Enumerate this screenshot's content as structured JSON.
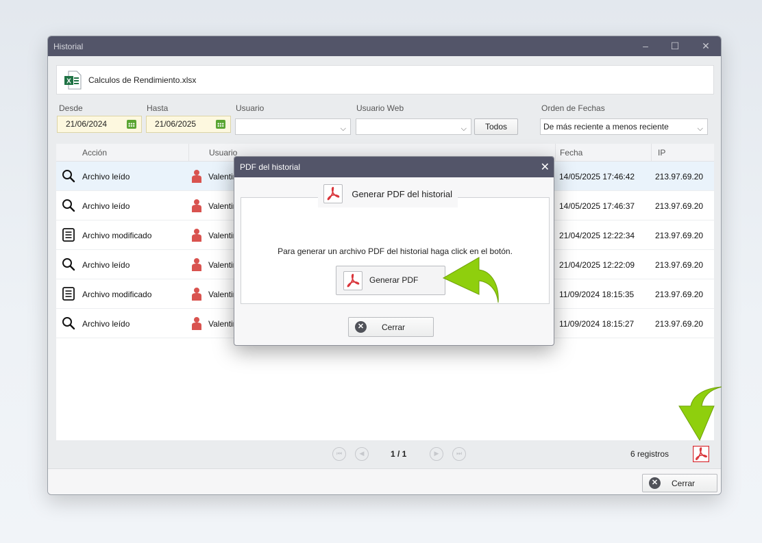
{
  "window": {
    "title": "Historial"
  },
  "file": {
    "name": "Calculos de Rendimiento.xlsx",
    "icon": "excel-icon"
  },
  "filters": {
    "desde_label": "Desde",
    "desde_value": "21/06/2024",
    "hasta_label": "Hasta",
    "hasta_value": "21/06/2025",
    "usuario_label": "Usuario",
    "usuario_value": "",
    "usuario_web_label": "Usuario Web",
    "usuario_web_value": "",
    "todos_label": "Todos",
    "orden_label": "Orden de Fechas",
    "orden_value": "De más reciente a menos reciente"
  },
  "grid": {
    "columns": [
      "Acción",
      "Usuario",
      "Fecha",
      "IP"
    ],
    "rows": [
      {
        "icon": "search-icon",
        "accion": "Archivo leído",
        "usuario": "Valentin",
        "fecha": "14/05/2025 17:46:42",
        "ip": "213.97.69.20"
      },
      {
        "icon": "search-icon",
        "accion": "Archivo leído",
        "usuario": "Valentin",
        "fecha": "14/05/2025 17:46:37",
        "ip": "213.97.69.20"
      },
      {
        "icon": "document-icon",
        "accion": "Archivo modificado",
        "usuario": "Valentin",
        "fecha": "21/04/2025 12:22:34",
        "ip": "213.97.69.20"
      },
      {
        "icon": "search-icon",
        "accion": "Archivo leído",
        "usuario": "Valentin",
        "fecha": "21/04/2025 12:22:09",
        "ip": "213.97.69.20"
      },
      {
        "icon": "document-icon",
        "accion": "Archivo modificado",
        "usuario": "Valentin",
        "fecha": "11/09/2024 18:15:35",
        "ip": "213.97.69.20"
      },
      {
        "icon": "search-icon",
        "accion": "Archivo leído",
        "usuario": "Valentin",
        "fecha": "11/09/2024 18:15:27",
        "ip": "213.97.69.20"
      }
    ]
  },
  "pager": {
    "page": "1 / 1",
    "count": "6 registros"
  },
  "footer": {
    "close_label": "Cerrar"
  },
  "dialog": {
    "title": "PDF del historial",
    "group_title": "Generar PDF del historial",
    "message": "Para generar un archivo PDF del historial haga click en el botón.",
    "generate_label": "Generar PDF",
    "close_label": "Cerrar"
  },
  "colors": {
    "titlebar": "#535569",
    "pdf_red": "#d9343a",
    "arrow_green": "#8fcf0d",
    "user_red": "#d9534f",
    "excel_green": "#1f7244"
  }
}
